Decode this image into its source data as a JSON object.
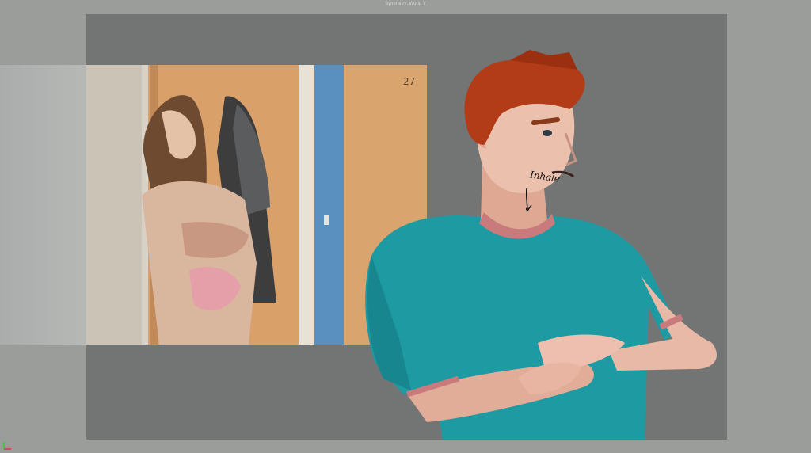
{
  "window": {
    "title": "Symmetry: World Y"
  },
  "reference": {
    "frame_number": "27"
  },
  "annotation": {
    "text": "Inhale"
  },
  "icons": {
    "axis": "axis-gizmo-icon",
    "arrow": "down-arrow-icon"
  },
  "colors": {
    "viewport_bg": "#737574",
    "shirt": "#1e9aa3",
    "hair": "#b23c17",
    "skin": "#e8b9a6",
    "trim": "#c97a7c"
  }
}
